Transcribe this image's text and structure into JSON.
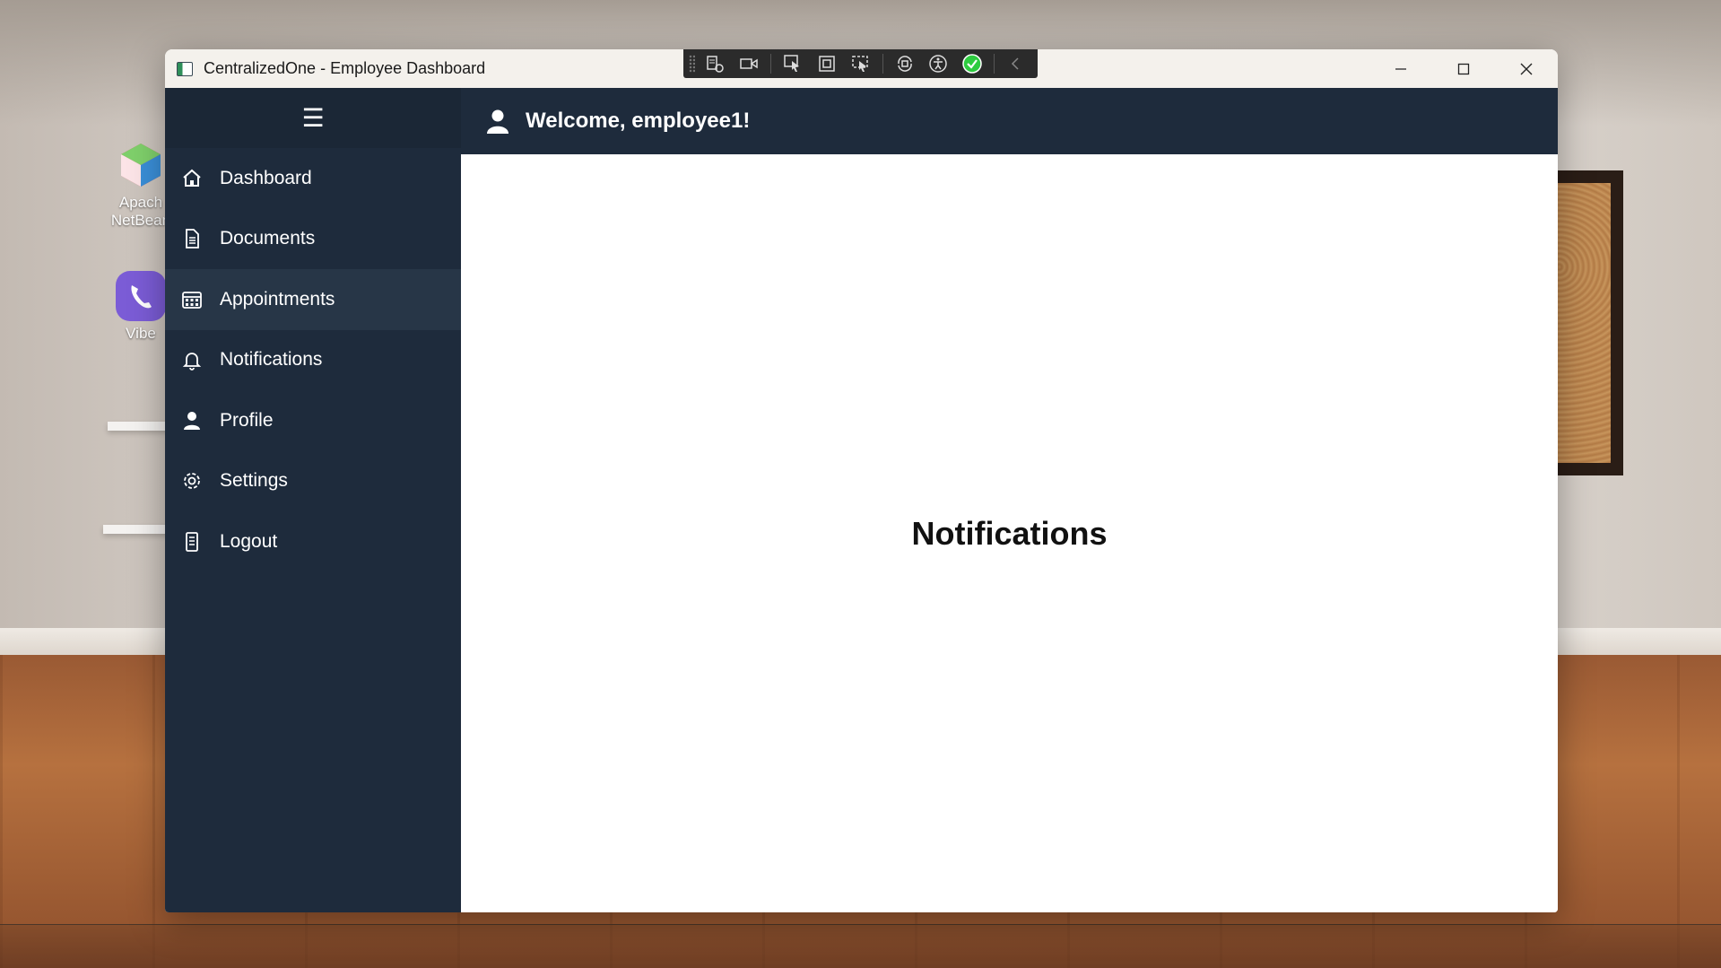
{
  "window": {
    "title": "CentralizedOne - Employee Dashboard",
    "controls": [
      "minimize-icon",
      "maximize-icon",
      "close-icon"
    ]
  },
  "dev_toolbar": {
    "icons": [
      "live-visual-tree-icon",
      "record-icon",
      "select-element-icon",
      "display-layout-adorners-icon",
      "track-focus-icon",
      "hot-reload-icon",
      "accessibility-icon",
      "binding-check-icon",
      "collapse-icon"
    ],
    "accent": "#2ecc40"
  },
  "desktop": {
    "icons": [
      {
        "label_line1": "Apach",
        "label_line2": "NetBean",
        "icon": "netbeans-icon"
      },
      {
        "label_line1": "Vibe",
        "icon": "viber-icon"
      }
    ]
  },
  "sidebar": {
    "menu_icon": "☰",
    "active_index": 2,
    "items": [
      {
        "label": "Dashboard",
        "icon": "home-icon"
      },
      {
        "label": "Documents",
        "icon": "document-icon"
      },
      {
        "label": "Appointments",
        "icon": "calendar-icon"
      },
      {
        "label": "Notifications",
        "icon": "bell-icon"
      },
      {
        "label": "Profile",
        "icon": "user-icon"
      },
      {
        "label": "Settings",
        "icon": "gear-icon"
      },
      {
        "label": "Logout",
        "icon": "logout-icon"
      }
    ]
  },
  "header": {
    "welcome": "Welcome, employee1!",
    "icon": "user-icon"
  },
  "main": {
    "title": "Notifications"
  },
  "colors": {
    "sidebar_bg": "#1e2b3c",
    "sidebar_active": "#273647",
    "header_bg": "#1e2b3c",
    "content_bg": "#ffffff",
    "titlebar_bg": "#f4f1ec"
  }
}
